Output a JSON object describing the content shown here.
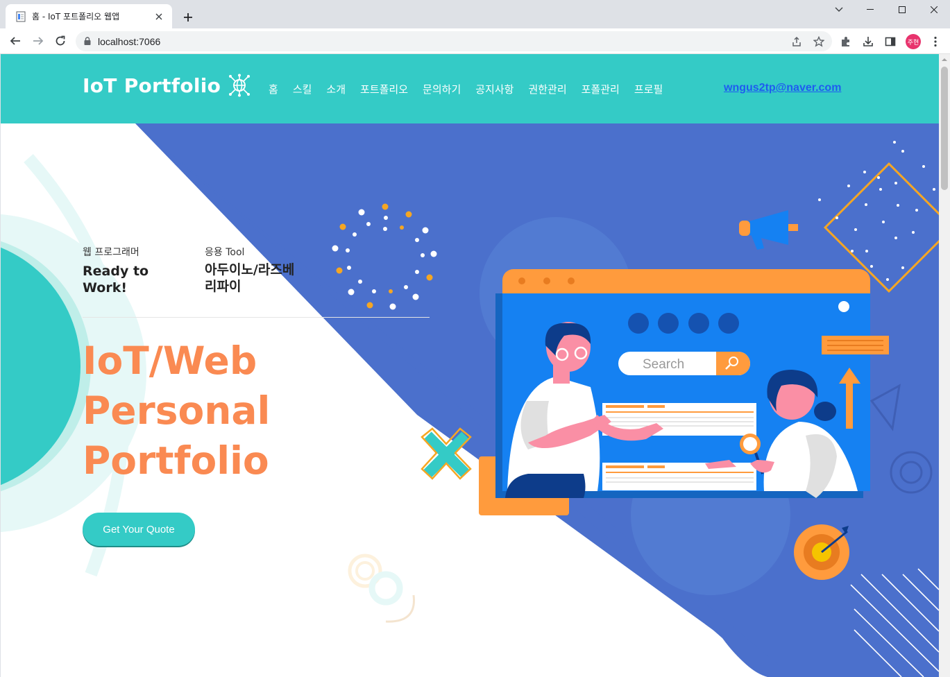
{
  "browser": {
    "tab_title": "홈 - IoT 포트폴리오 웹앱",
    "url": "localhost:7066",
    "profile_initials": "주현"
  },
  "site": {
    "brand": "IoT Portfolio",
    "nav": [
      "홈",
      "스킬",
      "소개",
      "포트폴리오",
      "문의하기",
      "공지사항",
      "권한관리",
      "포폴관리",
      "프로필"
    ],
    "email": "wngus2tp@naver.com"
  },
  "hero": {
    "meta": [
      {
        "label": "웹 프로그래머",
        "value_lines": [
          "Ready to",
          "Work!"
        ]
      },
      {
        "label": "응용 Tool",
        "value_lines": [
          "아두이노/라즈베",
          "리파이"
        ]
      }
    ],
    "title_lines": [
      "IoT/Web",
      "Personal",
      "Portfolio"
    ],
    "cta": "Get Your Quote",
    "illustration_search": "Search"
  },
  "colors": {
    "header_teal": "#34cbc6",
    "hero_blue": "#4b70cc",
    "accent_orange": "#fa8a52",
    "email_link": "#1e5cf0"
  }
}
